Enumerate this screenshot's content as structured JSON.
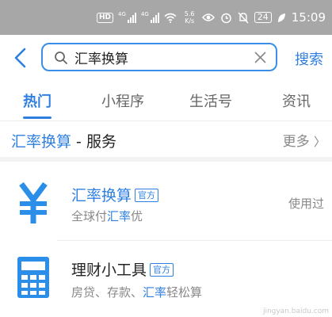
{
  "status_bar": {
    "hd_label": "HD",
    "signal1_label": "4G",
    "signal2_label": "4G",
    "speed_value": "5.6",
    "speed_unit": "K/s",
    "battery": "24",
    "time": "15:09"
  },
  "search": {
    "query": "汇率换算",
    "button_label": "搜索"
  },
  "tabs": [
    {
      "label": "热门"
    },
    {
      "label": "小程序"
    },
    {
      "label": "生活号"
    },
    {
      "label": "资讯"
    }
  ],
  "section": {
    "title_highlight": "汇率换算",
    "title_rest": " - 服务",
    "more_label": "更多"
  },
  "results": [
    {
      "name": "汇率换算",
      "badge": "官方",
      "desc_pre": "全球付",
      "desc_hl": "汇率",
      "desc_post": "优",
      "status": "使用过"
    },
    {
      "name": "理财小工具",
      "badge": "官方",
      "desc_pre": "房贷、存款、",
      "desc_hl": "汇率",
      "desc_post": "轻松算"
    }
  ],
  "watermark": "jingyan.baidu.com",
  "colors": {
    "accent": "#2f7fe0",
    "status_bar": "#a7a7a7",
    "icon_blue": "#2b8ee8"
  }
}
